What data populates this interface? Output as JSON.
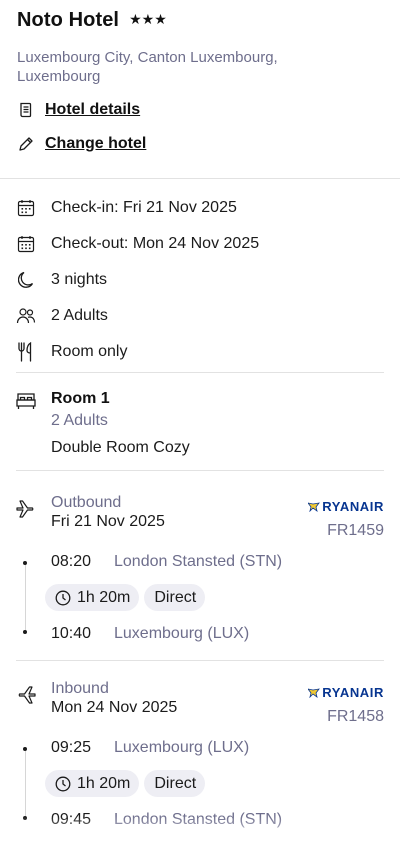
{
  "hotel": {
    "name": "Noto Hotel",
    "stars": 3,
    "star_glyph": "★★★",
    "address": "Luxembourg City, Canton Luxembourg, Luxembourg",
    "details_link": "Hotel details",
    "change_link": "Change hotel"
  },
  "stay": {
    "check_in": "Check-in: Fri 21 Nov 2025",
    "check_out": "Check-out: Mon 24 Nov 2025",
    "nights": "3 nights",
    "guests": "2 Adults",
    "board": "Room only"
  },
  "room": {
    "title": "Room 1",
    "adults": "2 Adults",
    "type": "Double Room Cozy"
  },
  "flights": {
    "outbound": {
      "label": "Outbound",
      "date": "Fri 21 Nov 2025",
      "airline": "RYANAIR",
      "flight_number": "FR1459",
      "depart_time": "08:20",
      "depart_airport": "London Stansted (STN)",
      "duration": "1h 20m",
      "stops": "Direct",
      "arrive_time": "10:40",
      "arrive_airport": "Luxembourg (LUX)"
    },
    "inbound": {
      "label": "Inbound",
      "date": "Mon 24 Nov 2025",
      "airline": "RYANAIR",
      "flight_number": "FR1458",
      "depart_time": "09:25",
      "depart_airport": "Luxembourg (LUX)",
      "duration": "1h 20m",
      "stops": "Direct",
      "arrive_time": "09:45",
      "arrive_airport": "London Stansted (STN)"
    }
  },
  "colors": {
    "text": "#1b1b1b",
    "muted": "#6e6e8c",
    "pill_bg": "#eeeef4",
    "divider": "#e2e2e2",
    "ryanair_blue": "#073590",
    "ryanair_yellow": "#f1c933"
  }
}
